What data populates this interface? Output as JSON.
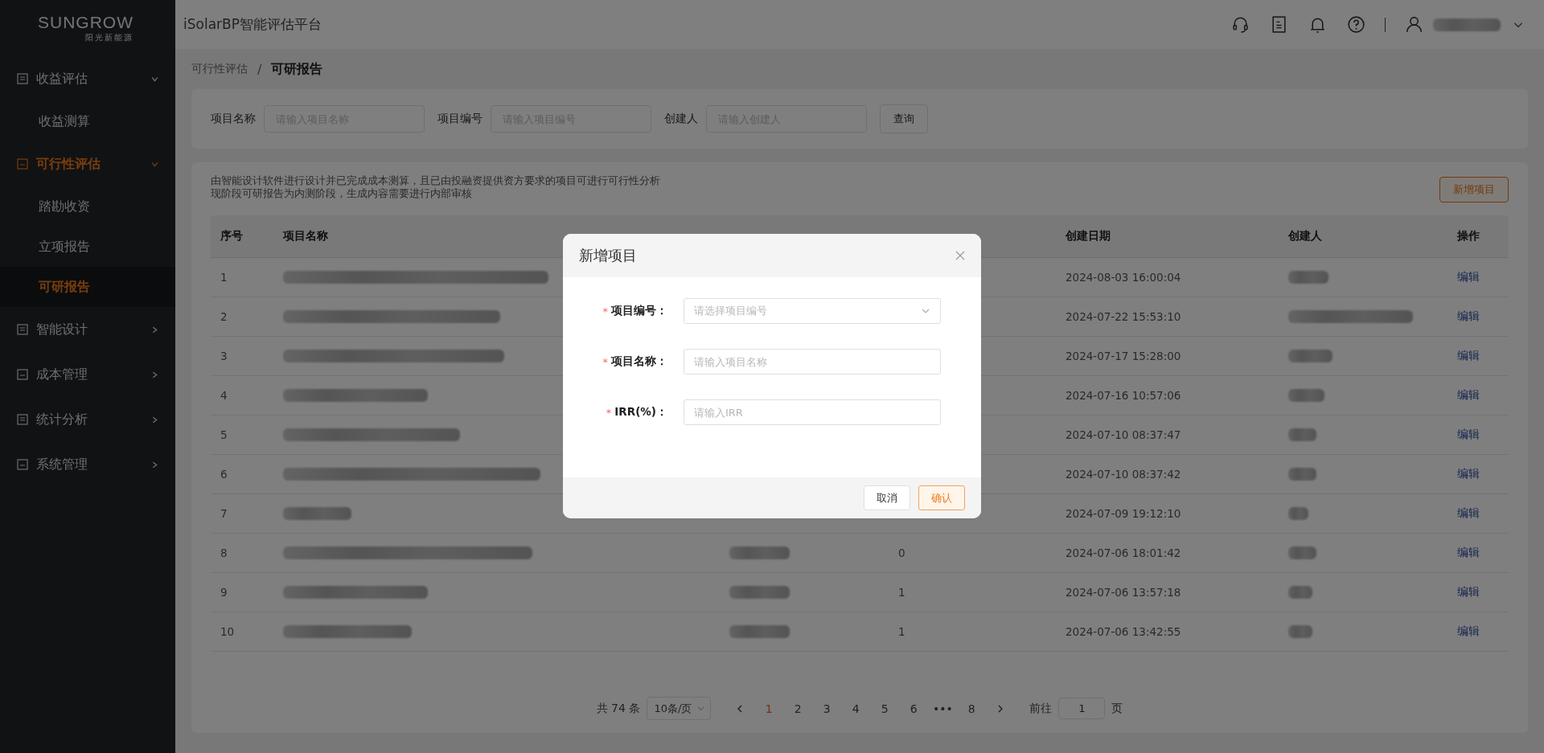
{
  "sidebar": {
    "logo": {
      "wordmark": "SUNGROW",
      "tagline": "阳光新能源"
    },
    "menu": [
      {
        "label": "收益评估",
        "expanded": true,
        "selected": false,
        "children": [
          {
            "label": "收益测算",
            "selected": false
          }
        ]
      },
      {
        "label": "可行性评估",
        "expanded": true,
        "selected": true,
        "children": [
          {
            "label": "踏勘收资",
            "selected": false
          },
          {
            "label": "立项报告",
            "selected": false
          },
          {
            "label": "可研报告",
            "selected": true
          }
        ]
      },
      {
        "label": "智能设计",
        "expanded": false,
        "selected": false
      },
      {
        "label": "成本管理",
        "expanded": false,
        "selected": false
      },
      {
        "label": "统计分析",
        "expanded": false,
        "selected": false
      },
      {
        "label": "系统管理",
        "expanded": false,
        "selected": false
      }
    ]
  },
  "header": {
    "title": "iSolarBP智能评估平台"
  },
  "breadcrumb": {
    "items": [
      "可行性评估",
      "可研报告"
    ],
    "separator": "/"
  },
  "search": {
    "fields": [
      {
        "label": "项目名称",
        "placeholder": "请输入项目名称"
      },
      {
        "label": "项目编号",
        "placeholder": "请输入项目编号"
      },
      {
        "label": "创建人",
        "placeholder": "请输入创建人"
      }
    ],
    "button": "查询"
  },
  "notice": [
    "由智能设计软件进行设计并已完成成本测算，且已由投融资提供资方要求的项目可进行可行性分析",
    "现阶段可研报告为内测阶段，生成内容需要进行内部审核"
  ],
  "add_button": "新增项目",
  "table": {
    "columns": [
      "序号",
      "项目名称",
      "创建日期",
      "创建人",
      "操作"
    ],
    "rows": [
      {
        "index": "1",
        "date": "2024-08-03 16:00:04",
        "action": "编辑"
      },
      {
        "index": "2",
        "date": "2024-07-22 15:53:10",
        "action": "编辑"
      },
      {
        "index": "3",
        "date": "2024-07-17 15:28:00",
        "action": "编辑"
      },
      {
        "index": "4",
        "date": "2024-07-16 10:57:06",
        "action": "编辑"
      },
      {
        "index": "5",
        "date": "2024-07-10 08:37:47",
        "action": "编辑"
      },
      {
        "index": "6",
        "date": "2024-07-10 08:37:42",
        "action": "编辑"
      },
      {
        "index": "7",
        "date": "2024-07-09 19:12:10",
        "action": "编辑"
      },
      {
        "index": "8",
        "reports": "0",
        "date": "2024-07-06 18:01:42",
        "action": "编辑"
      },
      {
        "index": "9",
        "reports": "1",
        "date": "2024-07-06 13:57:18",
        "action": "编辑"
      },
      {
        "index": "10",
        "reports": "1",
        "date": "2024-07-06 13:42:55",
        "action": "编辑"
      }
    ]
  },
  "pagination": {
    "total": "共 74 条",
    "page_size": "10条/页",
    "pages": [
      {
        "label": "1",
        "selected": true
      },
      {
        "label": "2",
        "selected": false
      },
      {
        "label": "3",
        "selected": false
      },
      {
        "label": "4",
        "selected": false
      },
      {
        "label": "5",
        "selected": false
      },
      {
        "label": "6",
        "selected": false
      },
      {
        "label": "•••",
        "selected": false
      },
      {
        "label": "8",
        "selected": false
      }
    ],
    "goto_label": "前往",
    "goto_value": "1",
    "page_unit": "页"
  },
  "modal": {
    "title": "新增项目",
    "required_mark": "*",
    "fields": [
      {
        "kind": "select",
        "label": "项目编号：",
        "required": true,
        "placeholder": "请选择项目编号"
      },
      {
        "kind": "input",
        "label": "项目名称：",
        "required": true,
        "placeholder": "请输入项目名称"
      },
      {
        "kind": "input",
        "label": "IRR(%)：",
        "required": true,
        "placeholder": "请输入IRR"
      }
    ],
    "buttons": [
      {
        "label": "取消",
        "kind": "default"
      },
      {
        "label": "确认",
        "kind": "primary"
      }
    ]
  }
}
